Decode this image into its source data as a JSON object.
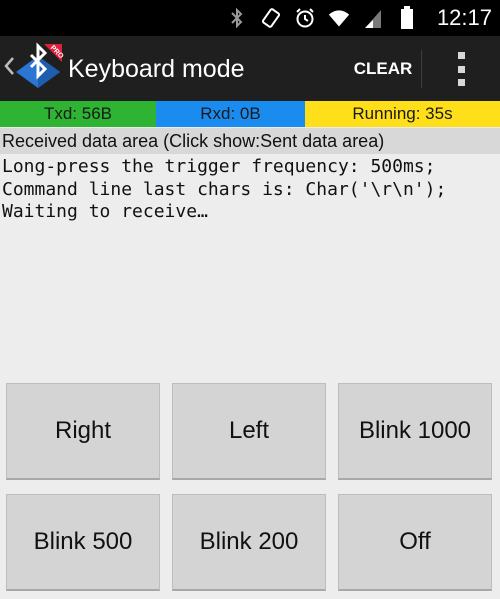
{
  "status_bar": {
    "time": "12:17",
    "icons": [
      "bluetooth-icon",
      "vibrate-icon",
      "alarm-icon",
      "wifi-icon",
      "signal-icon",
      "battery-icon"
    ]
  },
  "action_bar": {
    "title": "Keyboard mode",
    "clear_label": "CLEAR",
    "logo_badge": "PRO"
  },
  "counters": {
    "txd": "Txd: 56B",
    "rxd": "Rxd: 0B",
    "running": "Running: 35s"
  },
  "area_header": "Received data area  (Click show:Sent data area)",
  "received_lines": [
    "Long-press the trigger frequency: 500ms;",
    "Command line last chars is: Char('\\r\\n');",
    "Waiting to receive…"
  ],
  "buttons": [
    "Right",
    "Left",
    "Blink 1000",
    "Blink 500",
    "Blink 200",
    "Off"
  ],
  "colors": {
    "txd_bg": "#2eb332",
    "rxd_bg": "#1a8cf0",
    "running_bg": "#ffde1a",
    "action_bar_bg": "#1f1f1f",
    "logo_blue": "#2a76d2",
    "logo_red": "#e0203a"
  }
}
